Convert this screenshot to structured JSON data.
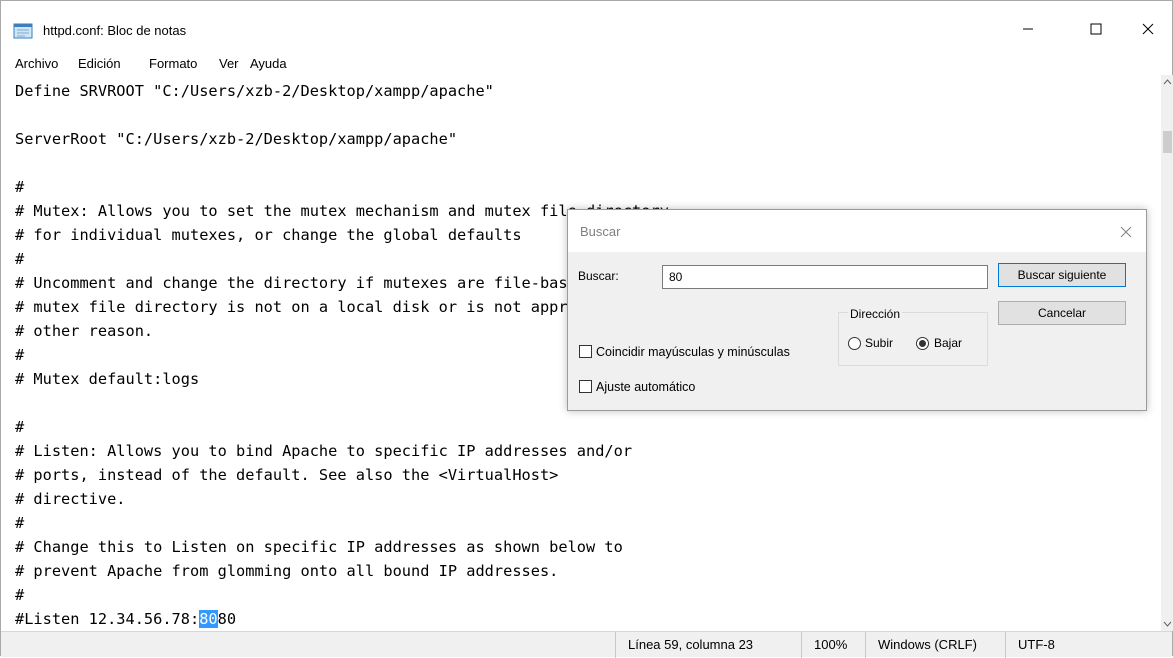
{
  "window": {
    "title": "httpd.conf: Bloc de notas",
    "controls": {
      "minimize": "minimize-icon",
      "maximize": "maximize-icon",
      "close": "close-icon"
    }
  },
  "menu": {
    "items": [
      {
        "label": "Archivo"
      },
      {
        "label": "Edición"
      },
      {
        "label": "Formato"
      },
      {
        "label": "Ver"
      },
      {
        "label": "Ayuda"
      }
    ]
  },
  "editor": {
    "lines": [
      "Define SRVROOT \"C:/Users/xzb-2/Desktop/xampp/apache\"",
      "",
      "ServerRoot \"C:/Users/xzb-2/Desktop/xampp/apache\"",
      "",
      "#",
      "# Mutex: Allows you to set the mutex mechanism and mutex file directory",
      "# for individual mutexes, or change the global defaults",
      "#",
      "# Uncomment and change the directory if mutexes are file-based and the default",
      "# mutex file directory is not on a local disk or is not appropriate for some",
      "# other reason.",
      "#",
      "# Mutex default:logs",
      "",
      "#",
      "# Listen: Allows you to bind Apache to specific IP addresses and/or",
      "# ports, instead of the default. See also the <VirtualHost>",
      "# directive.",
      "#",
      "# Change this to Listen on specific IP addresses as shown below to",
      "# prevent Apache from glomming onto all bound IP addresses.",
      "#"
    ],
    "last_line_prefix": "#Listen 12.34.56.78:",
    "last_line_selected": "80",
    "last_line_suffix": "80"
  },
  "status": {
    "position": "Línea 59, columna 23",
    "zoom": "100%",
    "line_ending": "Windows (CRLF)",
    "encoding": "UTF-8"
  },
  "find_dialog": {
    "title": "Buscar",
    "search_label": "Buscar:",
    "search_value": "80",
    "find_next_label": "Buscar siguiente",
    "cancel_label": "Cancelar",
    "direction_label": "Dirección",
    "up_label": "Subir",
    "down_label": "Bajar",
    "direction_selected": "Bajar",
    "match_case_label": "Coincidir mayúsculas y minúsculas",
    "match_case_checked": false,
    "wrap_label": "Ajuste automático",
    "wrap_checked": false
  },
  "colors": {
    "selection": "#3399ff",
    "dialog_bg": "#f0f0f0",
    "default_button_border": "#0078d7"
  }
}
